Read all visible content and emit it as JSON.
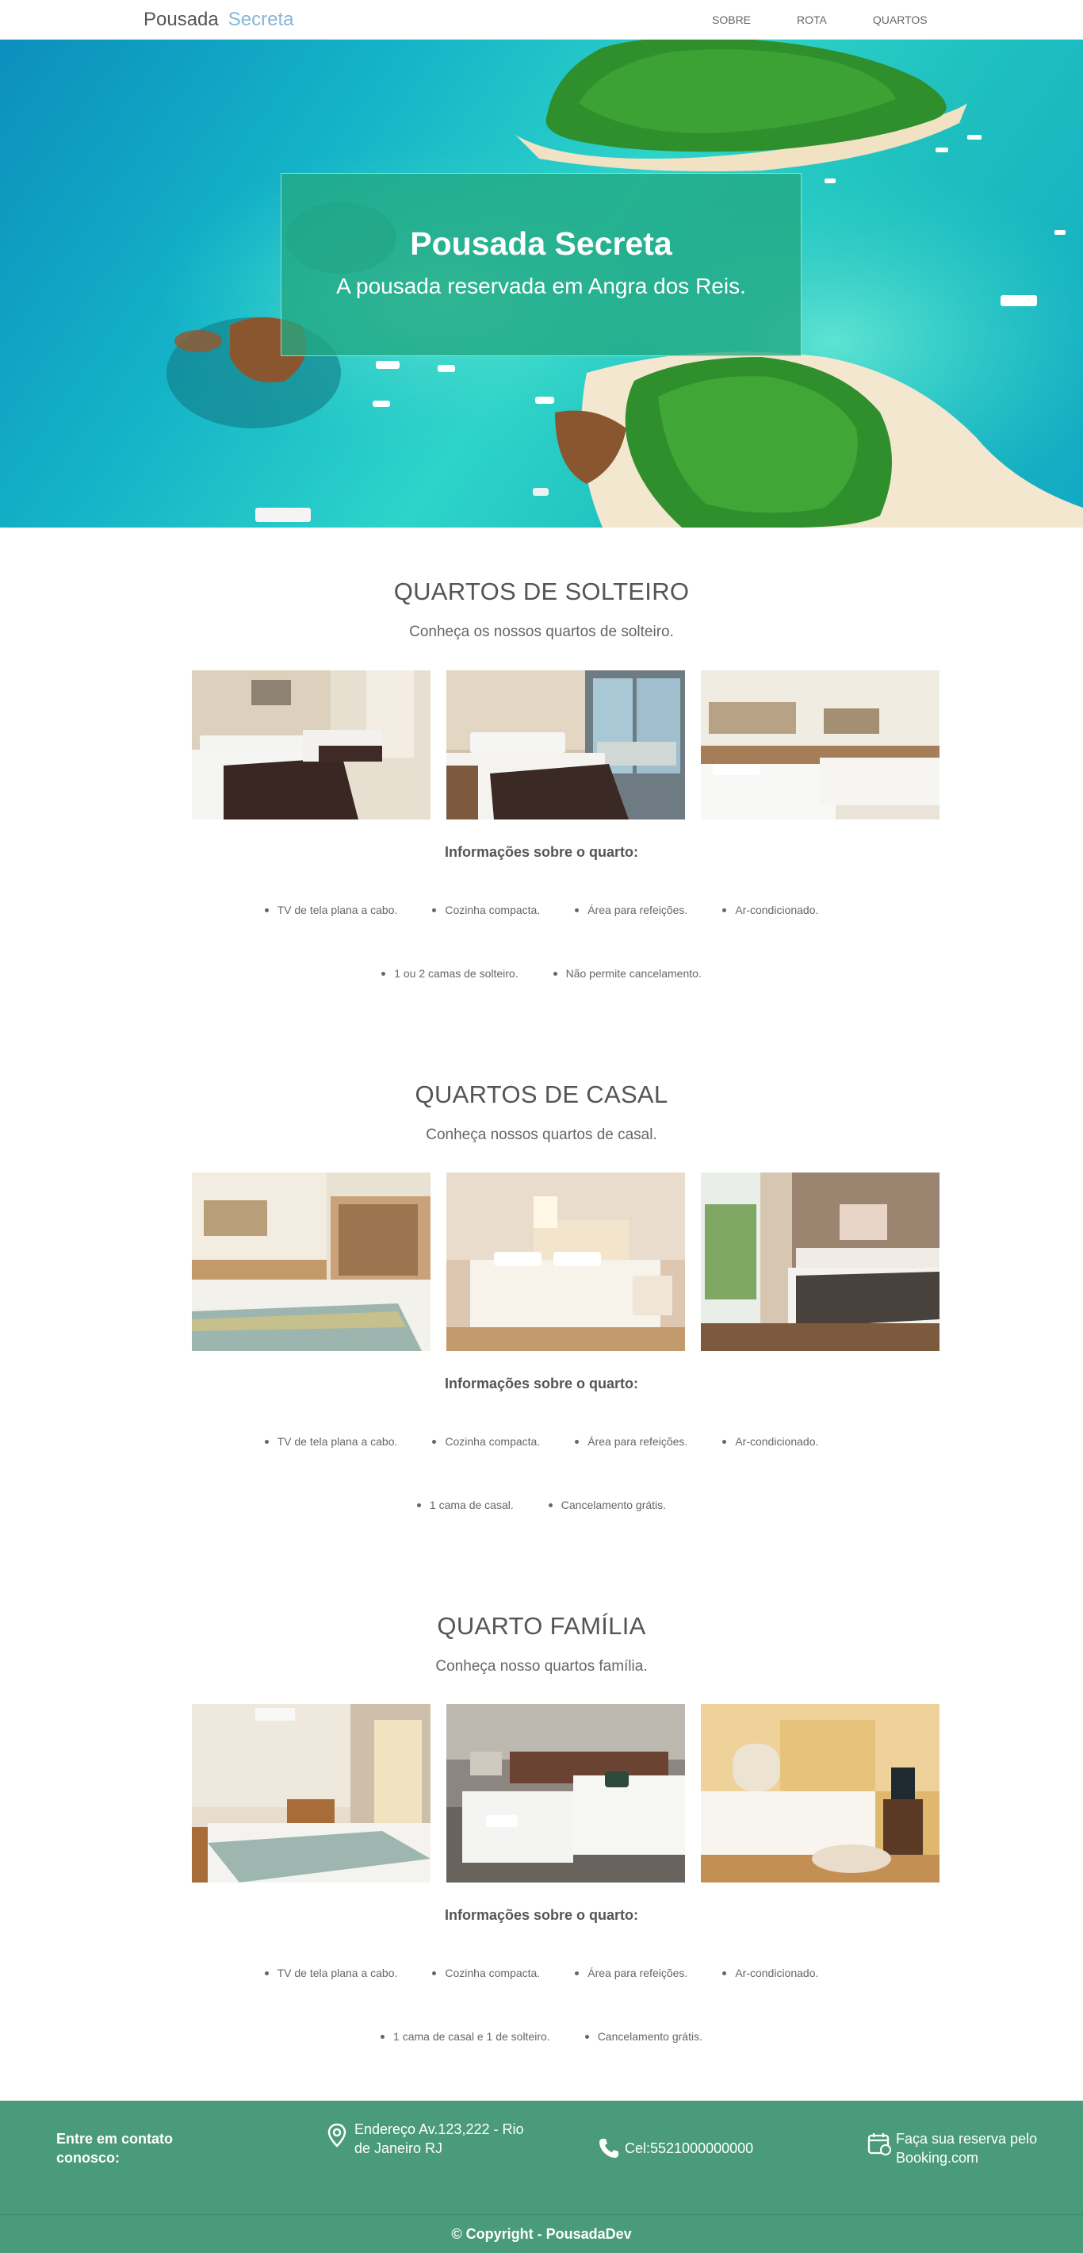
{
  "nav": {
    "brand_part1": "Pousada",
    "brand_part2": "Secreta",
    "links": [
      "SOBRE",
      "ROTA",
      "QUARTOS"
    ]
  },
  "hero": {
    "title": "Pousada Secreta",
    "subtitle": "A pousada reservada em Angra dos Reis."
  },
  "sections": [
    {
      "title": "QUARTOS DE SOLTEIRO",
      "subtitle": "Conheça os nossos quartos de solteiro.",
      "info_title": "Informações sobre o quarto:",
      "amenities_row1": [
        "TV de tela plana a cabo.",
        "Cozinha compacta.",
        "Área para refeições.",
        "Ar-condicionado."
      ],
      "amenities_row2": [
        "1 ou 2 camas de solteiro.",
        "Não permite cancelamento."
      ]
    },
    {
      "title": "QUARTOS DE CASAL",
      "subtitle": "Conheça nossos quartos de casal.",
      "info_title": "Informações sobre o quarto:",
      "amenities_row1": [
        "TV de tela plana a cabo.",
        "Cozinha compacta.",
        "Área para refeições.",
        "Ar-condicionado."
      ],
      "amenities_row2": [
        "1 cama de casal.",
        "Cancelamento grátis."
      ]
    },
    {
      "title": "QUARTO FAMÍLIA",
      "subtitle": "Conheça nosso quartos família.",
      "info_title": "Informações sobre o quarto:",
      "amenities_row1": [
        "TV de tela plana a cabo.",
        "Cozinha compacta.",
        "Área para refeições.",
        "Ar-condicionado."
      ],
      "amenities_row2": [
        "1 cama de casal e 1 de solteiro.",
        "Cancelamento grátis."
      ]
    }
  ],
  "footer": {
    "contact": "Entre em contato conosco:",
    "address": "Endereço Av.123,222 - Rio de Janeiro RJ",
    "phone": "Cel:5521000000000",
    "booking": "Faça sua reserva pelo Booking.com",
    "copyright": "© Copyright - PousadaDev"
  },
  "colors": {
    "footer_bg": "#4a9b7b",
    "hero_box": "#22a882",
    "brand_accent": "#87b6d6"
  }
}
